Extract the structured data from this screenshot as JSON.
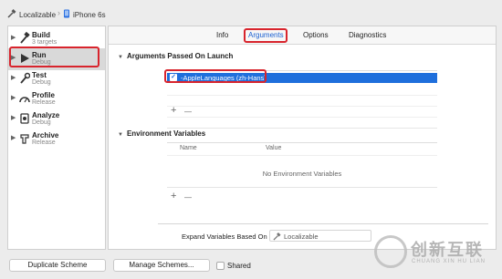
{
  "breadcrumb": {
    "project": "Localizable",
    "device": "iPhone 6s"
  },
  "sidebar": {
    "items": [
      {
        "label": "Build",
        "sub": "3 targets"
      },
      {
        "label": "Run",
        "sub": "Debug"
      },
      {
        "label": "Test",
        "sub": "Debug"
      },
      {
        "label": "Profile",
        "sub": "Release"
      },
      {
        "label": "Analyze",
        "sub": "Debug"
      },
      {
        "label": "Archive",
        "sub": "Release"
      }
    ],
    "selected": "Run"
  },
  "tabs": {
    "info": "Info",
    "arguments": "Arguments",
    "options": "Options",
    "diagnostics": "Diagnostics",
    "active": "Arguments"
  },
  "arguments": {
    "title": "Arguments Passed On Launch",
    "items": [
      {
        "checked": true,
        "text": "-AppleLanguages (zh-Hans)"
      }
    ]
  },
  "env": {
    "title": "Environment Variables",
    "col_name": "Name",
    "col_value": "Value",
    "empty": "No Environment Variables"
  },
  "controls": {
    "add": "+",
    "remove": "—"
  },
  "expand": {
    "label": "Expand Variables Based On",
    "value": "Localizable"
  },
  "footer": {
    "duplicate": "Duplicate Scheme",
    "manage": "Manage Schemes...",
    "shared": "Shared"
  },
  "watermark": {
    "text": "创新互联",
    "sub": "CHUANG XIN HU LIAN"
  },
  "colors": {
    "selection": "#1f6fdc",
    "annotation": "#d8242d",
    "tab_active": "#1a5fd1"
  }
}
